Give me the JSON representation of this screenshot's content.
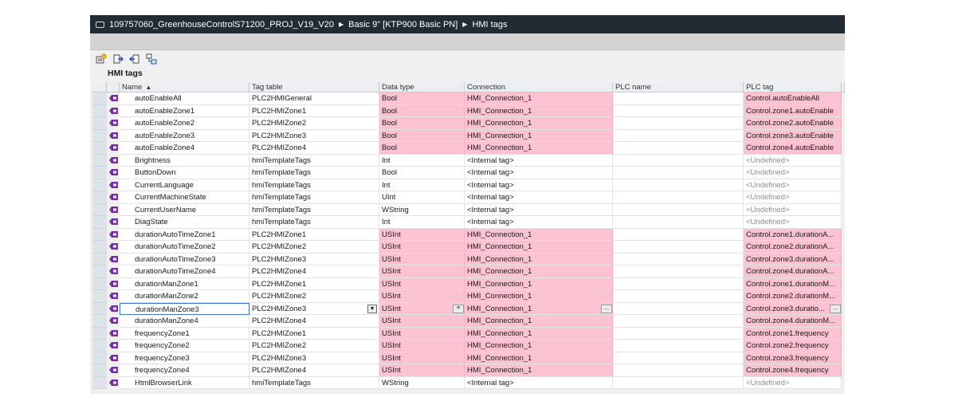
{
  "breadcrumb": {
    "project": "109757060_GreenhouseControlS71200_PROJ_V19_V20",
    "device": "Basic 9\" [KTP900 Basic PN]",
    "page": "HMI tags"
  },
  "section_title": "HMI tags",
  "toolbar": {
    "icons": [
      "add-tag-icon",
      "export-icon",
      "import-icon",
      "sync-icon"
    ]
  },
  "columns": {
    "name": "Name",
    "sort_indicator": "▲",
    "tag_table": "Tag table",
    "data_type": "Data type",
    "connection": "Connection",
    "plc_name": "PLC name",
    "plc_tag": "PLC tag"
  },
  "colors": {
    "error_highlight": "#fbc3d1",
    "titlebar": "#222a33",
    "selection": "#3f73c4",
    "tag_icon": "#7d2aa8"
  },
  "selected_row": 17,
  "rows": [
    {
      "name": "autoEnableAll",
      "table": "PLC2HMIGeneral",
      "type": "Bool",
      "conn": "HMI_Connection_1",
      "plc": "",
      "plctag": "Control.autoEnableAll",
      "err": true
    },
    {
      "name": "autoEnableZone1",
      "table": "PLC2HMIZone1",
      "type": "Bool",
      "conn": "HMI_Connection_1",
      "plc": "",
      "plctag": "Control.zone1.autoEnable",
      "err": true
    },
    {
      "name": "autoEnableZone2",
      "table": "PLC2HMIZone2",
      "type": "Bool",
      "conn": "HMI_Connection_1",
      "plc": "",
      "plctag": "Control.zone2.autoEnable",
      "err": true
    },
    {
      "name": "autoEnableZone3",
      "table": "PLC2HMIZone3",
      "type": "Bool",
      "conn": "HMI_Connection_1",
      "plc": "",
      "plctag": "Control.zone3.autoEnable",
      "err": true
    },
    {
      "name": "autoEnableZone4",
      "table": "PLC2HMIZone4",
      "type": "Bool",
      "conn": "HMI_Connection_1",
      "plc": "",
      "plctag": "Control.zone4.autoEnable",
      "err": true
    },
    {
      "name": "Brightness",
      "table": "hmiTemplateTags",
      "type": "Int",
      "conn": "<Internal tag>",
      "plc": "",
      "plctag": "<Undefined>",
      "err": false
    },
    {
      "name": "ButtonDown",
      "table": "hmiTemplateTags",
      "type": "Bool",
      "conn": "<Internal tag>",
      "plc": "",
      "plctag": "<Undefined>",
      "err": false
    },
    {
      "name": "CurrentLanguage",
      "table": "hmiTemplateTags",
      "type": "Int",
      "conn": "<Internal tag>",
      "plc": "",
      "plctag": "<Undefined>",
      "err": false
    },
    {
      "name": "CurrentMachineState",
      "table": "hmiTemplateTags",
      "type": "UInt",
      "conn": "<Internal tag>",
      "plc": "",
      "plctag": "<Undefined>",
      "err": false
    },
    {
      "name": "CurrentUserName",
      "table": "hmiTemplateTags",
      "type": "WString",
      "conn": "<Internal tag>",
      "plc": "",
      "plctag": "<Undefined>",
      "err": false
    },
    {
      "name": "DiagState",
      "table": "hmiTemplateTags",
      "type": "Int",
      "conn": "<Internal tag>",
      "plc": "",
      "plctag": "<Undefined>",
      "err": false
    },
    {
      "name": "durationAutoTimeZone1",
      "table": "PLC2HMIZone1",
      "type": "USInt",
      "conn": "HMI_Connection_1",
      "plc": "",
      "plctag": "Control.zone1.durationA...",
      "err": true
    },
    {
      "name": "durationAutoTimeZone2",
      "table": "PLC2HMIZone2",
      "type": "USInt",
      "conn": "HMI_Connection_1",
      "plc": "",
      "plctag": "Control.zone2.durationA...",
      "err": true
    },
    {
      "name": "durationAutoTimeZone3",
      "table": "PLC2HMIZone3",
      "type": "USInt",
      "conn": "HMI_Connection_1",
      "plc": "",
      "plctag": "Control.zone3.durationA...",
      "err": true
    },
    {
      "name": "durationAutoTimeZone4",
      "table": "PLC2HMIZone4",
      "type": "USInt",
      "conn": "HMI_Connection_1",
      "plc": "",
      "plctag": "Control.zone4.durationA...",
      "err": true
    },
    {
      "name": "durationManZone1",
      "table": "PLC2HMIZone1",
      "type": "USInt",
      "conn": "HMI_Connection_1",
      "plc": "",
      "plctag": "Control.zone1.durationM...",
      "err": true
    },
    {
      "name": "durationManZone2",
      "table": "PLC2HMIZone2",
      "type": "USInt",
      "conn": "HMI_Connection_1",
      "plc": "",
      "plctag": "Control.zone2.durationM...",
      "err": true
    },
    {
      "name": "durationManZone3",
      "table": "PLC2HMIZone3",
      "type": "USInt",
      "conn": "HMI_Connection_1",
      "plc": "",
      "plctag": "Control.zone3.duratio...",
      "err": true
    },
    {
      "name": "durationManZone4",
      "table": "PLC2HMIZone4",
      "type": "USInt",
      "conn": "HMI_Connection_1",
      "plc": "",
      "plctag": "Control.zone4.durationM...",
      "err": true
    },
    {
      "name": "frequencyZone1",
      "table": "PLC2HMIZone1",
      "type": "USInt",
      "conn": "HMI_Connection_1",
      "plc": "",
      "plctag": "Control.zone1.frequency",
      "err": true
    },
    {
      "name": "frequencyZone2",
      "table": "PLC2HMIZone2",
      "type": "USInt",
      "conn": "HMI_Connection_1",
      "plc": "",
      "plctag": "Control.zone2.frequency",
      "err": true
    },
    {
      "name": "frequencyZone3",
      "table": "PLC2HMIZone3",
      "type": "USInt",
      "conn": "HMI_Connection_1",
      "plc": "",
      "plctag": "Control.zone3.frequency",
      "err": true
    },
    {
      "name": "frequencyZone4",
      "table": "PLC2HMIZone4",
      "type": "USInt",
      "conn": "HMI_Connection_1",
      "plc": "",
      "plctag": "Control.zone4.frequency",
      "err": true
    },
    {
      "name": "HtmlBrowserLink",
      "table": "hmiTemplateTags",
      "type": "WString",
      "conn": "<Internal tag>",
      "plc": "",
      "plctag": "<Undefined>",
      "err": false
    }
  ]
}
